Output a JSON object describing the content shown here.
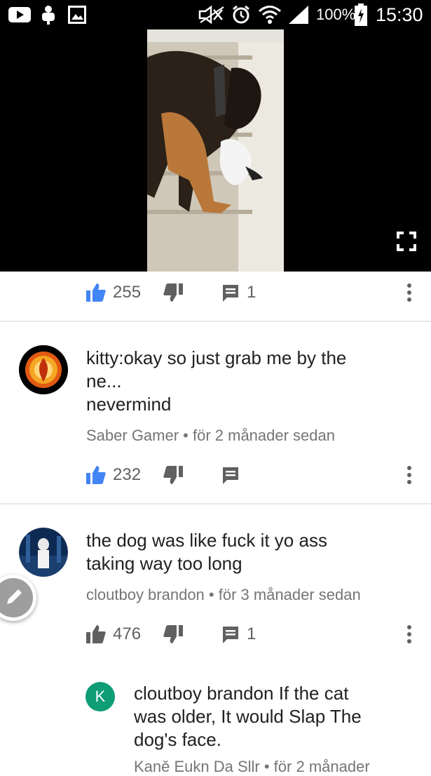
{
  "status_bar": {
    "battery": "100%",
    "time": "15:30"
  },
  "video_actions": {
    "likes": "255",
    "replies": "1"
  },
  "comments": [
    {
      "text_line1": "kitty:okay so just grab me by the",
      "text_line2": "ne...",
      "text_line3": "nevermind",
      "meta": "Saber Gamer • för 2 månader sedan",
      "likes": "232"
    },
    {
      "text_line1": "the dog was like fuck it yo ass",
      "text_line2": "taking way too long",
      "meta": "cloutboy brandon • för 3 månader sedan",
      "likes": "476",
      "replies": "1"
    }
  ],
  "reply": {
    "avatar_letter": "K",
    "text_line1": "cloutboy brandon  If the cat",
    "text_line2": "was older, It would Slap  The",
    "text_line3": "dog's face.",
    "meta_partial": "Kaně Eukn Da Sllr • för 2 månader"
  },
  "colors": {
    "like_active": "#4285f4",
    "reply_avatar": "#0f9d76",
    "icon_gray": "#606060"
  }
}
